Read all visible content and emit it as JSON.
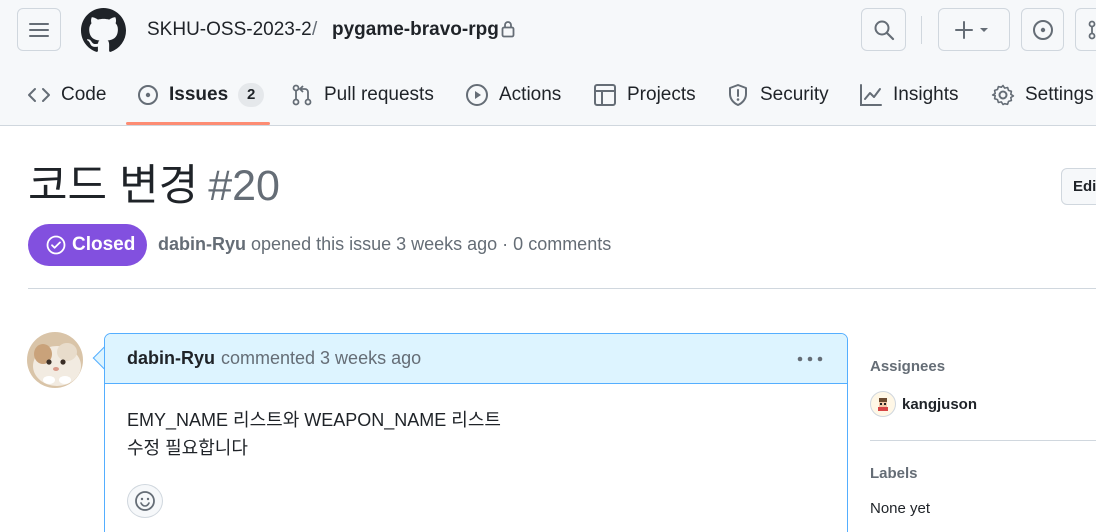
{
  "header": {
    "owner": "SKHU-OSS-2023-2",
    "separator": "/",
    "repo": "pygame-bravo-rpg"
  },
  "tabs": [
    {
      "label": "Code",
      "icon": "code-icon"
    },
    {
      "label": "Issues",
      "icon": "issue-opened-icon",
      "count": "2",
      "selected": true
    },
    {
      "label": "Pull requests",
      "icon": "git-pull-request-icon"
    },
    {
      "label": "Actions",
      "icon": "play-icon"
    },
    {
      "label": "Projects",
      "icon": "table-icon"
    },
    {
      "label": "Security",
      "icon": "shield-icon"
    },
    {
      "label": "Insights",
      "icon": "graph-icon"
    },
    {
      "label": "Settings",
      "icon": "gear-icon"
    }
  ],
  "issue": {
    "title": "코드 변경",
    "number": "#20",
    "edit_label": "Edit",
    "state": "Closed",
    "author": "dabin-Ryu",
    "meta_rest": "opened this issue 3 weeks ago · 0 comments"
  },
  "comment": {
    "author": "dabin-Ryu",
    "time": "commented 3 weeks ago",
    "body_line1": "EMY_NAME 리스트와 WEAPON_NAME 리스트",
    "body_line2": "수정 필요합니다"
  },
  "sidebar": {
    "assignees_heading": "Assignees",
    "assignee": "kangjuson",
    "labels_heading": "Labels",
    "labels_value": "None yet"
  },
  "colors": {
    "accent_underline": "#fd8c73",
    "closed_badge": "#8250df",
    "comment_header_bg": "#ddf4ff",
    "comment_border": "#54aeff"
  }
}
